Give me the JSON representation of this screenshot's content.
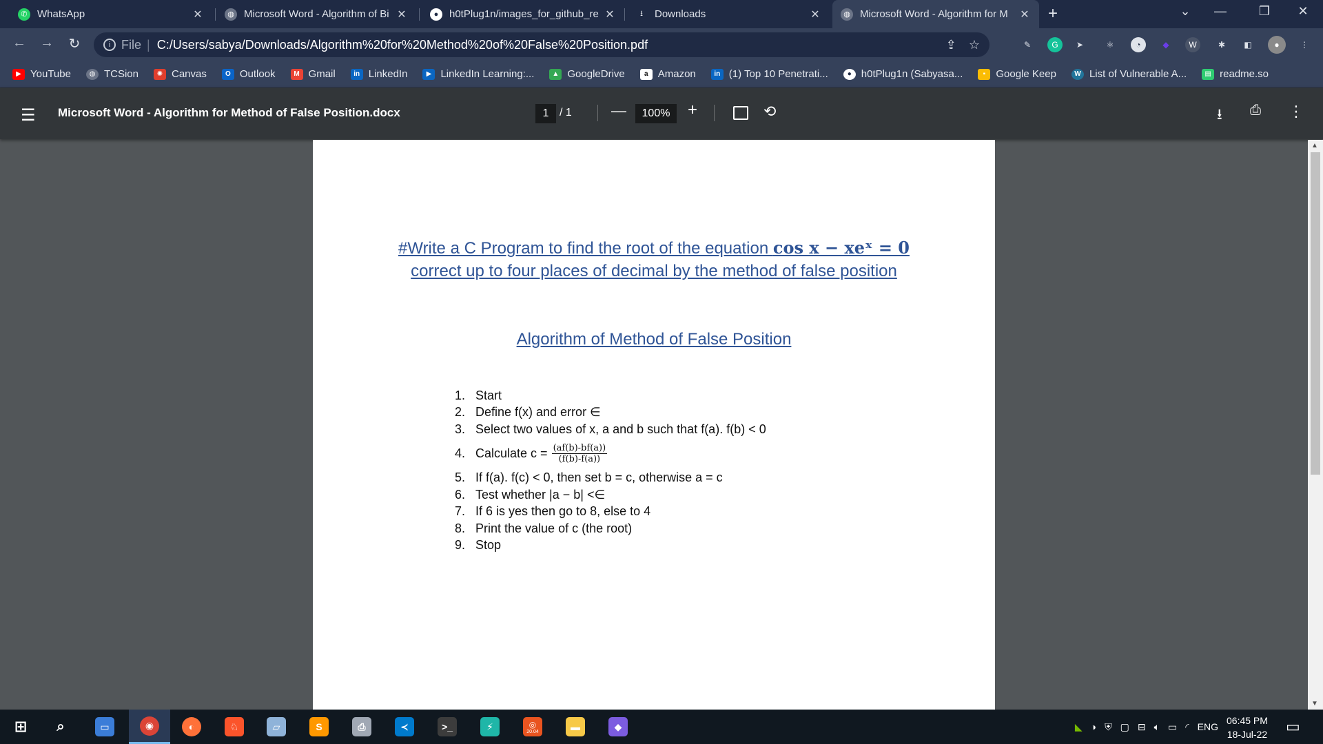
{
  "browser": {
    "tabs": [
      {
        "label": "WhatsApp",
        "icon": "whatsapp-icon",
        "color": "#25d366"
      },
      {
        "label": "Microsoft Word - Algorithm of Bi",
        "icon": "globe-icon",
        "color": "#6b7487"
      },
      {
        "label": "h0tPlug1n/images_for_github_re",
        "icon": "github-icon",
        "color": "#ffffff"
      },
      {
        "label": "Downloads",
        "icon": "download-icon",
        "color": "#dfe3ea"
      },
      {
        "label": "Microsoft Word - Algorithm for M",
        "icon": "globe-icon",
        "color": "#6b7487"
      }
    ],
    "address": {
      "scheme": "File",
      "url": "C:/Users/sabya/Downloads/Algorithm%20for%20Method%20of%20False%20Position.pdf"
    },
    "bookmarks": [
      {
        "label": "YouTube",
        "icon": "youtube-icon",
        "color": "#ff0000"
      },
      {
        "label": "TCSion",
        "icon": "globe-icon",
        "color": "#6b7487"
      },
      {
        "label": "Canvas",
        "icon": "canvas-icon",
        "color": "#e03e2d"
      },
      {
        "label": "Outlook",
        "icon": "outlook-icon",
        "color": "#0a64c8"
      },
      {
        "label": "Gmail",
        "icon": "gmail-icon",
        "color": "#ea4335"
      },
      {
        "label": "LinkedIn",
        "icon": "linkedin-icon",
        "color": "#0a66c2"
      },
      {
        "label": "LinkedIn Learning:...",
        "icon": "linkedin-learning-icon",
        "color": "#0a66c2"
      },
      {
        "label": "GoogleDrive",
        "icon": "google-drive-icon",
        "color": "#34a853"
      },
      {
        "label": "Amazon",
        "icon": "amazon-icon",
        "color": "#ffffff"
      },
      {
        "label": "(1) Top 10 Penetrati...",
        "icon": "linkedin-icon",
        "color": "#0a66c2"
      },
      {
        "label": "h0tPlug1n (Sabyasa...",
        "icon": "github-icon",
        "color": "#ffffff"
      },
      {
        "label": "Google Keep",
        "icon": "google-keep-icon",
        "color": "#fbbc04"
      },
      {
        "label": "List of Vulnerable A...",
        "icon": "wordpress-icon",
        "color": "#21759b"
      },
      {
        "label": "readme.so",
        "icon": "readme-icon",
        "color": "#2ecc71"
      }
    ]
  },
  "pdf_viewer": {
    "title": "Microsoft Word - Algorithm for Method of False Position.docx",
    "current_page": "1",
    "total_pages": "/ 1",
    "zoom": "100%"
  },
  "document": {
    "heading_prefix": "#Write a C Program to find the root of the equation ",
    "heading_equation": "cos x − xeˣ = 0",
    "heading_line2": "correct up to four places of decimal by the method of false position",
    "subheading": "Algorithm of Method of False Position",
    "steps": [
      {
        "num": "1.",
        "text": "Start"
      },
      {
        "num": "2.",
        "text": "Define f(x) and error ∈"
      },
      {
        "num": "3.",
        "text": "Select two values of x, a and b such that f(a). f(b) < 0"
      },
      {
        "num": "4.",
        "text": "Calculate c = ",
        "frac_num": "(af(b)-bf(a))",
        "frac_den": "(f(b)-f(a))"
      },
      {
        "num": "5.",
        "text": "If f(a). f(c) < 0, then set b = c, otherwise a = c"
      },
      {
        "num": "6.",
        "text": "Test whether |a − b| <∈"
      },
      {
        "num": "7.",
        "text": "If 6 is yes then go to 8, else to 4"
      },
      {
        "num": "8.",
        "text": "Print the value of c (the root)"
      },
      {
        "num": "9.",
        "text": "Stop"
      }
    ]
  },
  "taskbar": {
    "apps": [
      {
        "icon": "search-icon",
        "color": "#101820"
      },
      {
        "icon": "network-drive-icon",
        "color": "#3b7dd8"
      },
      {
        "icon": "chrome-icon",
        "color": "#db4437"
      },
      {
        "icon": "firefox-icon",
        "color": "#ff7139"
      },
      {
        "icon": "brave-icon",
        "color": "#fb542b"
      },
      {
        "icon": "notepad-icon",
        "color": "#8fb3d9"
      },
      {
        "icon": "sublime-text-icon",
        "color": "#ff9800"
      },
      {
        "icon": "printer-app-icon",
        "color": "#a0a8b4"
      },
      {
        "icon": "vscode-icon",
        "color": "#007acc"
      },
      {
        "icon": "terminal-icon",
        "color": "#3c3c3c"
      },
      {
        "icon": "app-icon",
        "color": "#1fb6a8"
      },
      {
        "icon": "ubuntu-icon",
        "color": "#e95420"
      },
      {
        "icon": "file-explorer-icon",
        "color": "#f7c948"
      },
      {
        "icon": "obsidian-icon",
        "color": "#7c5ce0"
      }
    ],
    "ubuntu_badge": "20.04",
    "language": "ENG",
    "time": "06:45 PM",
    "date": "18-Jul-22"
  }
}
